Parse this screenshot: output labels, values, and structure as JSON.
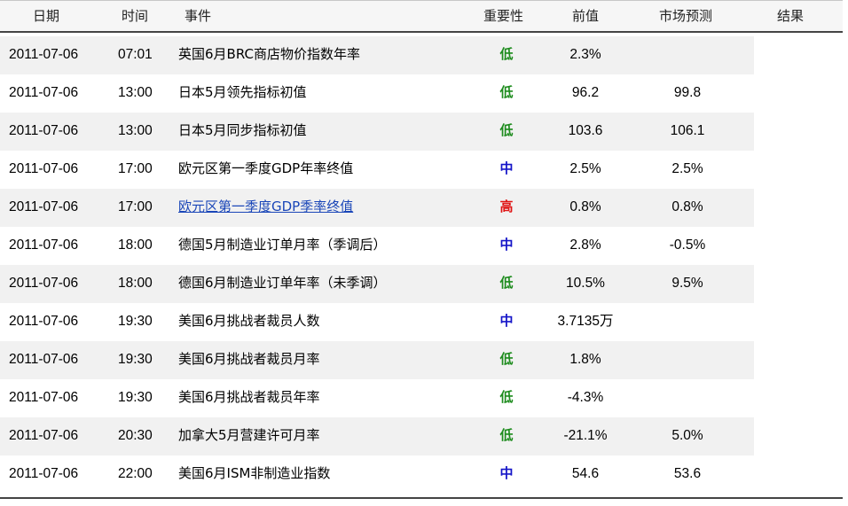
{
  "colors": {
    "low": "#1e8c1e",
    "medium": "#1414c8",
    "high": "#e01414",
    "link": "#1a46b8"
  },
  "header": {
    "date": "日期",
    "time": "时间",
    "event": "事件",
    "importance": "重要性",
    "previous": "前值",
    "forecast": "市场预测",
    "result": "结果"
  },
  "rows": [
    {
      "date": "2011-07-06",
      "time": "07:01",
      "event": "英国6月BRC商店物价指数年率",
      "importance": "低",
      "level": "low",
      "previous": "2.3%",
      "forecast": "",
      "result": "",
      "link": false
    },
    {
      "date": "2011-07-06",
      "time": "13:00",
      "event": "日本5月领先指标初值",
      "importance": "低",
      "level": "low",
      "previous": "96.2",
      "forecast": "99.8",
      "result": "",
      "link": false
    },
    {
      "date": "2011-07-06",
      "time": "13:00",
      "event": "日本5月同步指标初值",
      "importance": "低",
      "level": "low",
      "previous": "103.6",
      "forecast": "106.1",
      "result": "",
      "link": false
    },
    {
      "date": "2011-07-06",
      "time": "17:00",
      "event": "欧元区第一季度GDP年率终值",
      "importance": "中",
      "level": "medium",
      "previous": "2.5%",
      "forecast": "2.5%",
      "result": "",
      "link": false
    },
    {
      "date": "2011-07-06",
      "time": "17:00",
      "event": "欧元区第一季度GDP季率终值",
      "importance": "高",
      "level": "high",
      "previous": "0.8%",
      "forecast": "0.8%",
      "result": "",
      "link": true
    },
    {
      "date": "2011-07-06",
      "time": "18:00",
      "event": "德国5月制造业订单月率（季调后）",
      "importance": "中",
      "level": "medium",
      "previous": "2.8%",
      "forecast": "-0.5%",
      "result": "",
      "link": false
    },
    {
      "date": "2011-07-06",
      "time": "18:00",
      "event": "德国6月制造业订单年率（未季调）",
      "importance": "低",
      "level": "low",
      "previous": "10.5%",
      "forecast": "9.5%",
      "result": "",
      "link": false
    },
    {
      "date": "2011-07-06",
      "time": "19:30",
      "event": "美国6月挑战者裁员人数",
      "importance": "中",
      "level": "medium",
      "previous": "3.7135万",
      "forecast": "",
      "result": "",
      "link": false
    },
    {
      "date": "2011-07-06",
      "time": "19:30",
      "event": "美国6月挑战者裁员月率",
      "importance": "低",
      "level": "low",
      "previous": "1.8%",
      "forecast": "",
      "result": "",
      "link": false
    },
    {
      "date": "2011-07-06",
      "time": "19:30",
      "event": "美国6月挑战者裁员年率",
      "importance": "低",
      "level": "low",
      "previous": "-4.3%",
      "forecast": "",
      "result": "",
      "link": false
    },
    {
      "date": "2011-07-06",
      "time": "20:30",
      "event": "加拿大5月营建许可月率",
      "importance": "低",
      "level": "low",
      "previous": "-21.1%",
      "forecast": "5.0%",
      "result": "",
      "link": false
    },
    {
      "date": "2011-07-06",
      "time": "22:00",
      "event": "美国6月ISM非制造业指数",
      "importance": "中",
      "level": "medium",
      "previous": "54.6",
      "forecast": "53.6",
      "result": "",
      "link": false
    }
  ]
}
